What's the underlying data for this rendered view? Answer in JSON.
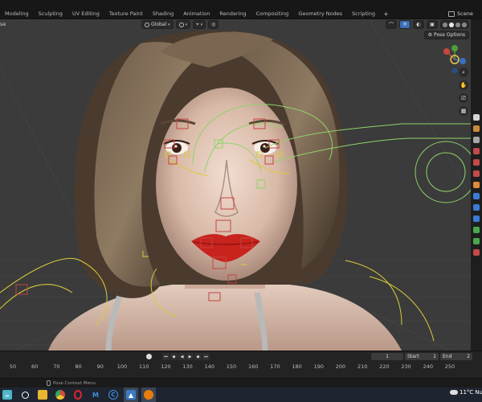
{
  "workspace_tabs": [
    "Modeling",
    "Sculpting",
    "UV Editing",
    "Texture Paint",
    "Shading",
    "Animation",
    "Rendering",
    "Compositing",
    "Geometry Nodes",
    "Scripting"
  ],
  "add_tab": "+",
  "scene_label": "Scene",
  "viewport": {
    "left_stub": "se",
    "transform_orientation": "Global",
    "pose_options_label": "Pose Options",
    "gizmo_axes": {
      "x": "X",
      "y": "Y",
      "z": "Z"
    },
    "colors": {
      "bg": "#3b3b3b",
      "rig_green": "#8fd36a",
      "rig_yellow": "#d8cc3a",
      "rig_red": "#c4453f",
      "grid": "#454545",
      "lips": "#c8231d"
    }
  },
  "timeline": {
    "current_frame": "1",
    "start_label": "Start",
    "start_value": "1",
    "end_label": "End",
    "end_value": "2",
    "ruler_labels": [
      "50",
      "60",
      "70",
      "80",
      "90",
      "100",
      "110",
      "120",
      "130",
      "140",
      "150",
      "160",
      "170",
      "180",
      "190",
      "200",
      "210",
      "220",
      "230",
      "240",
      "250"
    ]
  },
  "status_bar": {
    "hint": "Pose Context Menu"
  },
  "taskbar": {
    "weather_temp": "11°C",
    "weather_extra": "Nu",
    "apps": [
      "cup-app-icon",
      "search-circle-icon",
      "file-explorer-icon",
      "chrome-icon",
      "opera-icon",
      "malwarebytes-icon",
      "ccleaner-icon",
      "photo-app-icon",
      "blender-icon"
    ]
  }
}
